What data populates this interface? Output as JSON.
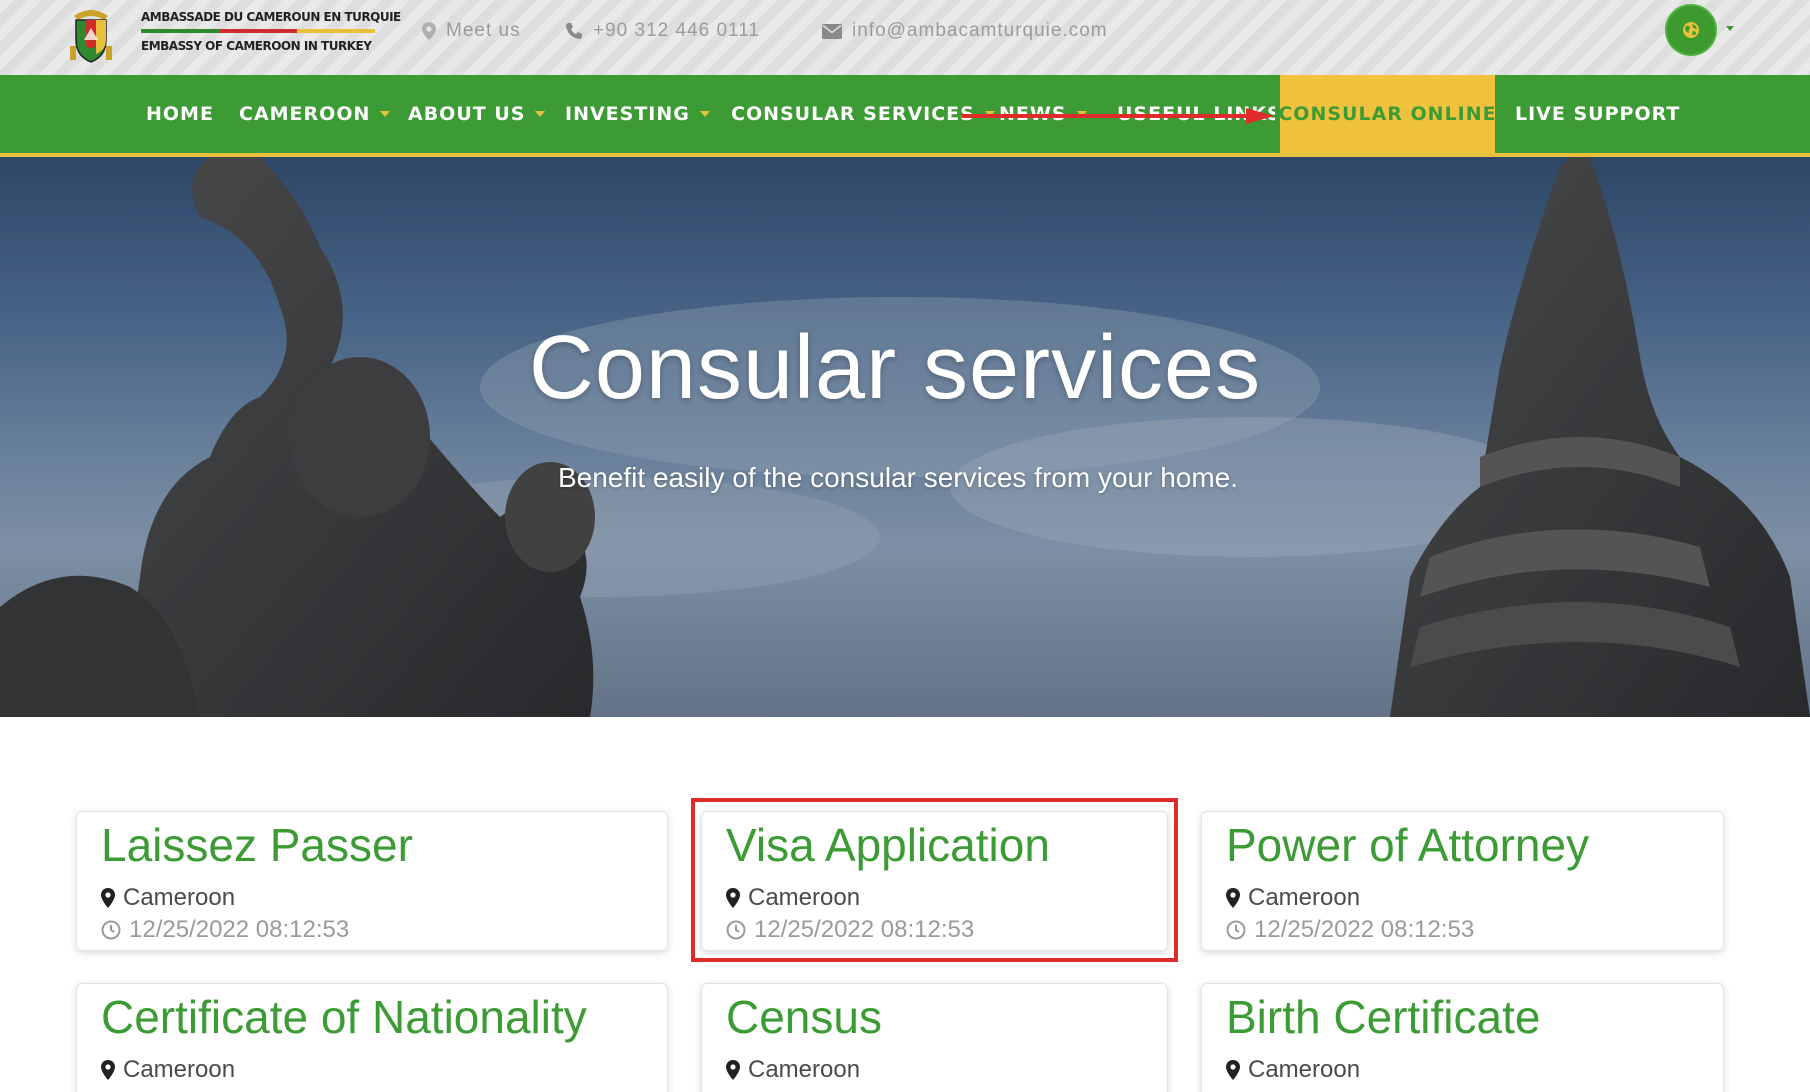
{
  "header": {
    "brand_fr": "AMBASSADE DU CAMEROUN EN TURQUIE",
    "brand_en": "EMBASSY OF CAMEROON IN TURKEY",
    "meet_us": "Meet us",
    "phone": "+90 312 446 0111",
    "email": "info@ambacamturquie.com"
  },
  "nav": {
    "items": [
      {
        "label": "HOME"
      },
      {
        "label": "CAMEROON"
      },
      {
        "label": "ABOUT US"
      },
      {
        "label": "INVESTING"
      },
      {
        "label": "CONSULAR SERVICES"
      },
      {
        "label": "NEWS"
      },
      {
        "label": "USEFUL LINKS"
      },
      {
        "label": "CONSULAR ONLINE"
      },
      {
        "label": "LIVE SUPPORT"
      }
    ]
  },
  "hero": {
    "title": "Consular services",
    "subtitle": "Benefit easily of the consular services from your home."
  },
  "cards": [
    {
      "title": "Laissez Passer",
      "location": "Cameroon",
      "date": "12/25/2022 08:12:53"
    },
    {
      "title": "Visa Application",
      "location": "Cameroon",
      "date": "12/25/2022 08:12:53"
    },
    {
      "title": "Power of Attorney",
      "location": "Cameroon",
      "date": "12/25/2022 08:12:53"
    },
    {
      "title": "Certificate of Nationality",
      "location": "Cameroon"
    },
    {
      "title": "Census",
      "location": "Cameroon"
    },
    {
      "title": "Birth Certificate",
      "location": "Cameroon"
    }
  ],
  "colors": {
    "brand_green": "#3d9b35",
    "accent_yellow": "#f0c23e",
    "annotation_red": "#e12b2b"
  },
  "icons": [
    "map-marker-icon",
    "phone-icon",
    "envelope-icon",
    "globe-icon",
    "clock-icon",
    "coat-of-arms-logo"
  ]
}
